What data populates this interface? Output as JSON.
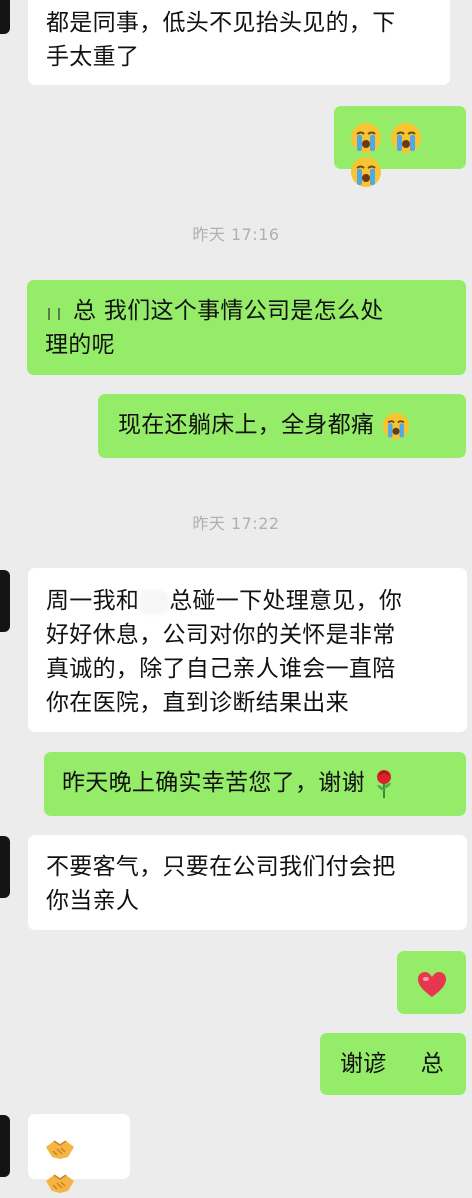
{
  "messages": [
    {
      "side": "in",
      "text_lines": [
        "都是同事，低头不见抬头见的，下",
        "手太重了"
      ]
    },
    {
      "side": "out",
      "emoji": [
        "loudly-crying-face",
        "loudly-crying-face",
        "loudly-crying-face"
      ]
    },
    {
      "timestamp": "昨天 17:16"
    },
    {
      "side": "out",
      "text_lines_parts": [
        [
          "",
          "总 我们这个事情公司是怎么处"
        ],
        [
          "理的呢"
        ]
      ]
    },
    {
      "side": "out",
      "text": "现在还躺床上，全身都痛",
      "trailing_emoji": "loudly-crying-face"
    },
    {
      "timestamp": "昨天 17:22"
    },
    {
      "side": "in",
      "text_lines_parts": [
        [
          "周一我和",
          "总碰一下处理意见，你"
        ],
        [
          "好好休息，公司对你的关怀是非常"
        ],
        [
          "真诚的，除了自己亲人谁会一直陪"
        ],
        [
          "你在医院，直到诊断结果出来"
        ]
      ]
    },
    {
      "side": "out",
      "text": "昨天晚上确实幸苦您了，谢谢",
      "trailing_emoji": "rose"
    },
    {
      "side": "in",
      "text_lines": [
        "不要客气，只要在公司我们付会把",
        "你当亲人"
      ]
    },
    {
      "side": "out",
      "emoji": [
        "heart"
      ]
    },
    {
      "side": "out",
      "text_parts": [
        "谢谚",
        "总"
      ]
    },
    {
      "side": "in",
      "emoji": [
        "handshake",
        "handshake"
      ]
    }
  ],
  "timestamps": [
    "昨天 17:16",
    "昨天 17:22"
  ],
  "text": {
    "m1_l1": "都是同事，低头不见抬头见的，下",
    "m1_l2": "手太重了",
    "ts1": "昨天 17:16",
    "m3_l1": "总 我们这个事情公司是怎么处",
    "m3_l2": "理的呢",
    "m4": "现在还躺床上，全身都痛",
    "ts2": "昨天 17:22",
    "m5_l1a": "周一我和",
    "m5_l1b": "总碰一下处理意见，你",
    "m5_l2": "好好休息，公司对你的关怀是非常",
    "m5_l3": "真诚的，除了自己亲人谁会一直陪",
    "m5_l4": "你在医院，直到诊断结果出来",
    "m6": "昨天晚上确实幸苦您了，谢谢",
    "m7_l1": "不要客气，只要在公司我们付会把",
    "m7_l2": "你当亲人",
    "m9a": "谢谚",
    "m9b": "总"
  },
  "colors": {
    "background": "#ececec",
    "incoming_bubble": "#ffffff",
    "outgoing_bubble": "#95ec69",
    "timestamp": "#b0b0b0"
  }
}
